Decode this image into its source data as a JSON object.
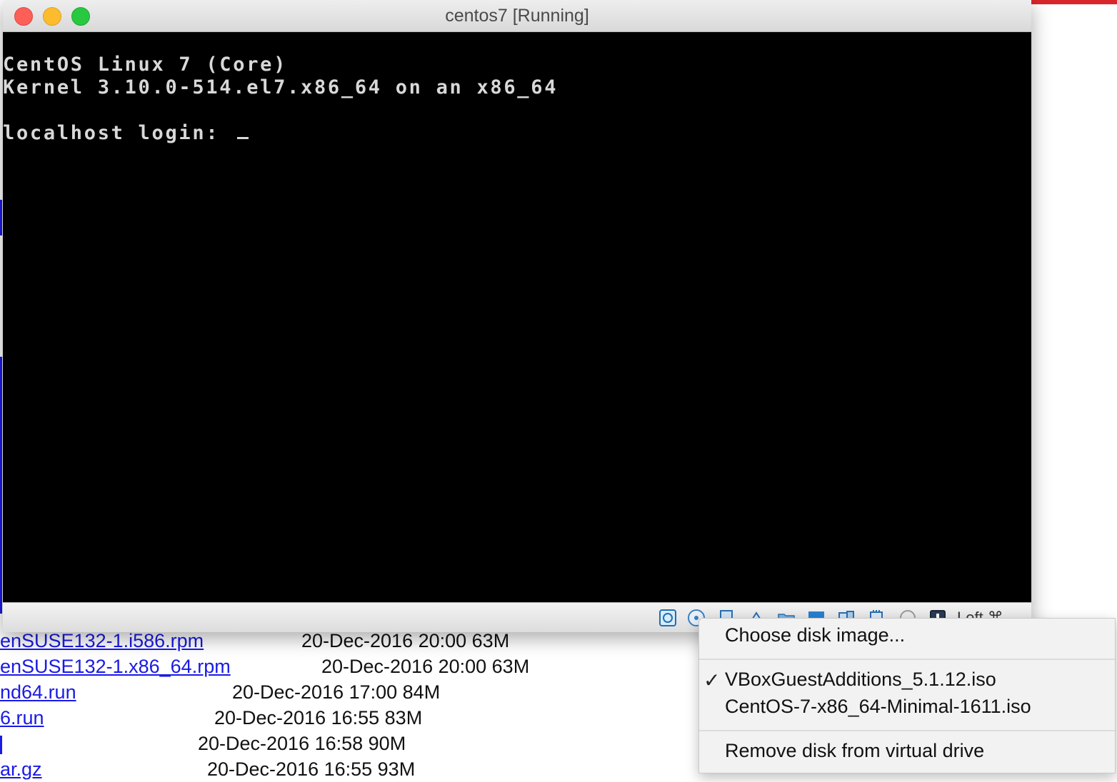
{
  "window": {
    "title": "centos7 [Running]"
  },
  "console": {
    "line1": "CentOS Linux 7 (Core)",
    "line2": "Kernel 3.10.0-514.el7.x86_64 on an x86_64",
    "line3": "localhost login: "
  },
  "statusbar": {
    "host_key": "Left ⌘"
  },
  "menu": {
    "choose_label": "Choose disk image...",
    "checkmark": "✓",
    "items": [
      "VBoxGuestAdditions_5.1.12.iso",
      "CentOS-7-x86_64-Minimal-1611.iso"
    ],
    "remove_label": "Remove disk from virtual drive"
  },
  "background_listing": [
    {
      "name": "enSUSE132-1.i586.rpm",
      "meta": "20-Dec-2016 20:00  63M"
    },
    {
      "name": "enSUSE132-1.x86_64.rpm",
      "meta": "20-Dec-2016 20:00  63M"
    },
    {
      "name": "nd64.run",
      "meta": "20-Dec-2016 17:00  84M"
    },
    {
      "name": "6.run",
      "meta": "20-Dec-2016 16:55  83M"
    },
    {
      "name": "",
      "meta": "20-Dec-2016 16:58  90M"
    },
    {
      "name": "ar.gz",
      "meta": "20-Dec-2016 16:55  93M"
    }
  ],
  "colors": {
    "accent_link": "#1a1ae6",
    "menu_bg": "#f2f2f2",
    "screen_bg": "#000000"
  }
}
